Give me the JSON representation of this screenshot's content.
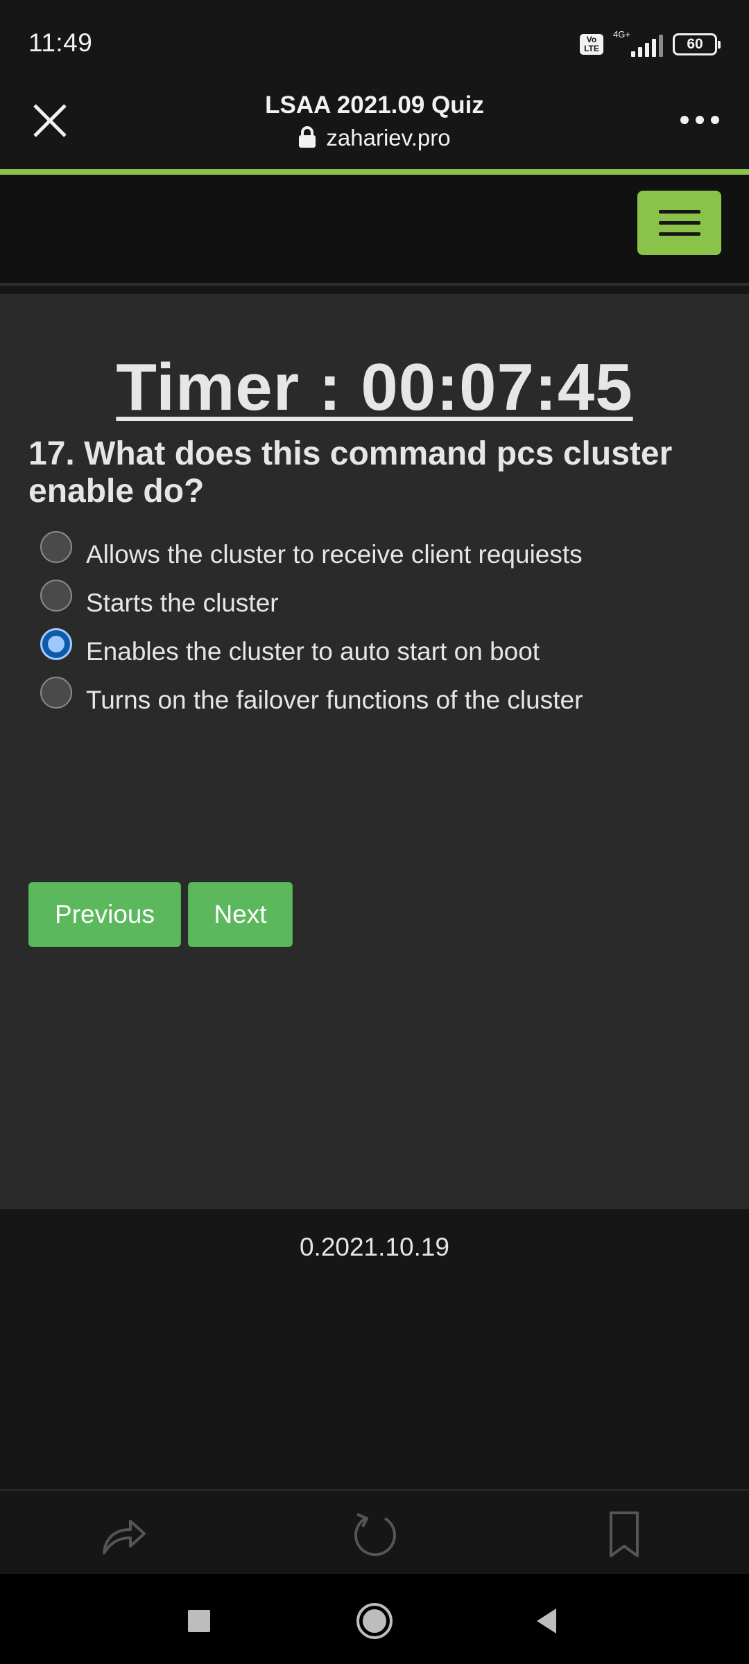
{
  "status_bar": {
    "time": "11:49",
    "volte": "Vo\nLTE",
    "network": "4G+",
    "battery": "60",
    "icons": [
      "volte-icon",
      "signal-icon",
      "battery-icon"
    ]
  },
  "browser": {
    "title": "LSAA 2021.09 Quiz",
    "url": "zahariev.pro",
    "icons": [
      "close-icon",
      "lock-icon",
      "more-icon"
    ],
    "progress_color": "#8bc34a"
  },
  "navbar": {
    "menu_icon": "hamburger-menu-icon",
    "accent": "#8bc34a"
  },
  "quiz": {
    "timer": "Timer : 00:07:45",
    "question_prefix": "17. What does this command ",
    "question_command": "pcs cluster enable",
    "question_suffix": " do?",
    "options": [
      {
        "label": "Allows the cluster to receive client requiests",
        "selected": false
      },
      {
        "label": "Starts the cluster",
        "selected": false
      },
      {
        "label": "Enables the cluster to auto start on boot",
        "selected": true
      },
      {
        "label": "Turns on the failover functions of the cluster",
        "selected": false
      }
    ],
    "previous_label": "Previous",
    "next_label": "Next",
    "button_color": "#5cb85c"
  },
  "footer": {
    "version": "0.2021.10.19"
  },
  "bottom_toolbar": {
    "icons": [
      "share-icon",
      "reload-icon",
      "bookmark-icon"
    ]
  },
  "system_nav": {
    "icons": [
      "recents-icon",
      "home-icon",
      "back-icon"
    ]
  }
}
